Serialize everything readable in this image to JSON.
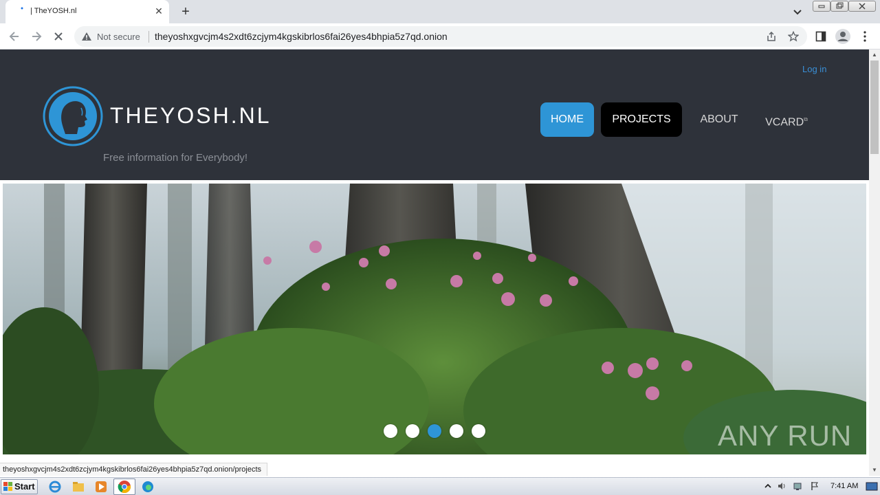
{
  "browser": {
    "tab_title": "| TheYOSH.nl",
    "new_tab_label": "+",
    "security_label": "Not secure",
    "url": "theyoshxgvcjm4s2xdt6zcjym4kgskibrlos6fai26yes4bhpia5z7qd.onion"
  },
  "site": {
    "login_label": "Log in",
    "brand": "THEYOSH.NL",
    "tagline": "Free information for Everybody!",
    "nav": {
      "home": "HOME",
      "projects": "PROJECTS",
      "about": "ABOUT",
      "vcard": "VCARD"
    },
    "slider": {
      "dot_count": 5,
      "active_dot": 3
    },
    "colors": {
      "header_bg": "#2e323a",
      "accent": "#2e95d6",
      "projects_bg": "#000000"
    }
  },
  "watermark": "ANY RUN",
  "status_url": "theyoshxgvcjm4s2xdt6zcjym4kgskibrlos6fai26yes4bhpia5z7qd.onion/projects",
  "taskbar": {
    "start_label": "Start",
    "clock": "7:41 AM"
  }
}
